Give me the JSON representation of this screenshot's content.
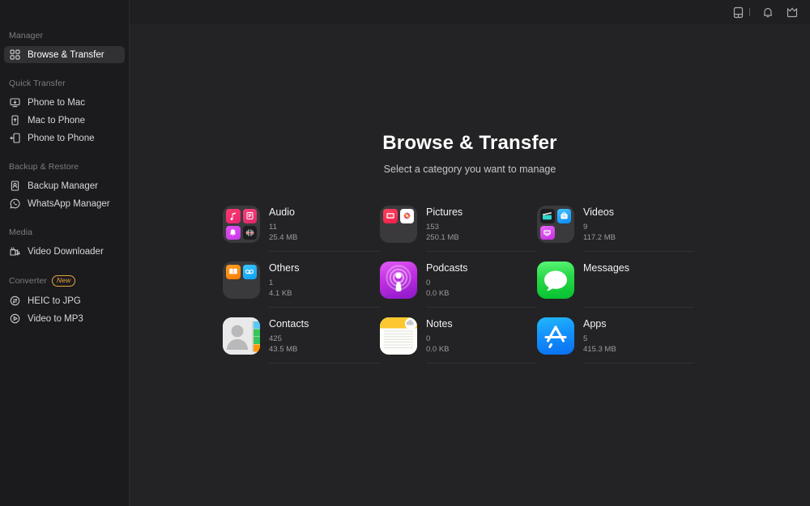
{
  "window": {
    "background": "#232325",
    "sidebar_background": "#1b1b1d"
  },
  "topbar": {
    "icons": [
      {
        "name": "device-icon",
        "label": "Device"
      },
      {
        "name": "bell-icon",
        "label": "Notifications"
      },
      {
        "name": "crown-icon",
        "label": "Upgrade"
      }
    ]
  },
  "sidebar": {
    "groups": [
      {
        "label": "Manager",
        "badge": null,
        "items": [
          {
            "label": "Browse & Transfer",
            "icon": "grid-icon",
            "active": true
          }
        ]
      },
      {
        "label": "Quick Transfer",
        "badge": null,
        "items": [
          {
            "label": "Phone to Mac",
            "icon": "phone-to-mac-icon",
            "active": false
          },
          {
            "label": "Mac to Phone",
            "icon": "mac-to-phone-icon",
            "active": false
          },
          {
            "label": "Phone to Phone",
            "icon": "phone-to-phone-icon",
            "active": false
          }
        ]
      },
      {
        "label": "Backup & Restore",
        "badge": null,
        "items": [
          {
            "label": "Backup Manager",
            "icon": "backup-icon",
            "active": false
          },
          {
            "label": "WhatsApp Manager",
            "icon": "whatsapp-icon",
            "active": false
          }
        ]
      },
      {
        "label": "Media",
        "badge": null,
        "items": [
          {
            "label": "Video Downloader",
            "icon": "video-download-icon",
            "active": false
          }
        ]
      },
      {
        "label": "Converter",
        "badge": "New",
        "items": [
          {
            "label": "HEIC to JPG",
            "icon": "heic-convert-icon",
            "active": false
          },
          {
            "label": "Video to MP3",
            "icon": "video-convert-icon",
            "active": false
          }
        ]
      }
    ]
  },
  "main": {
    "title": "Browse & Transfer",
    "subtitle": "Select a category you want to manage",
    "categories": [
      {
        "name": "Audio",
        "count": "11",
        "size": "25.4 MB",
        "icon": "audio-folder-icon"
      },
      {
        "name": "Pictures",
        "count": "153",
        "size": "250.1 MB",
        "icon": "pictures-folder-icon"
      },
      {
        "name": "Videos",
        "count": "9",
        "size": "117.2 MB",
        "icon": "videos-folder-icon"
      },
      {
        "name": "Others",
        "count": "1",
        "size": "4.1 KB",
        "icon": "others-folder-icon"
      },
      {
        "name": "Podcasts",
        "count": "0",
        "size": "0.0 KB",
        "icon": "podcasts-icon"
      },
      {
        "name": "Messages",
        "count": "",
        "size": "",
        "icon": "messages-icon"
      },
      {
        "name": "Contacts",
        "count": "425",
        "size": "43.5 MB",
        "icon": "contacts-icon"
      },
      {
        "name": "Notes",
        "count": "0",
        "size": "0.0 KB",
        "icon": "notes-icon"
      },
      {
        "name": "Apps",
        "count": "5",
        "size": "415.3 MB",
        "icon": "apps-icon"
      }
    ]
  },
  "colors": {
    "accent_new_badge": "#e8a33d",
    "active_item": "#313134",
    "messages_green": "#2ad94a",
    "apps_blue": "#0b84fe",
    "podcasts_purple": "#c13fe8",
    "notes_yellow": "#fdc82f"
  }
}
